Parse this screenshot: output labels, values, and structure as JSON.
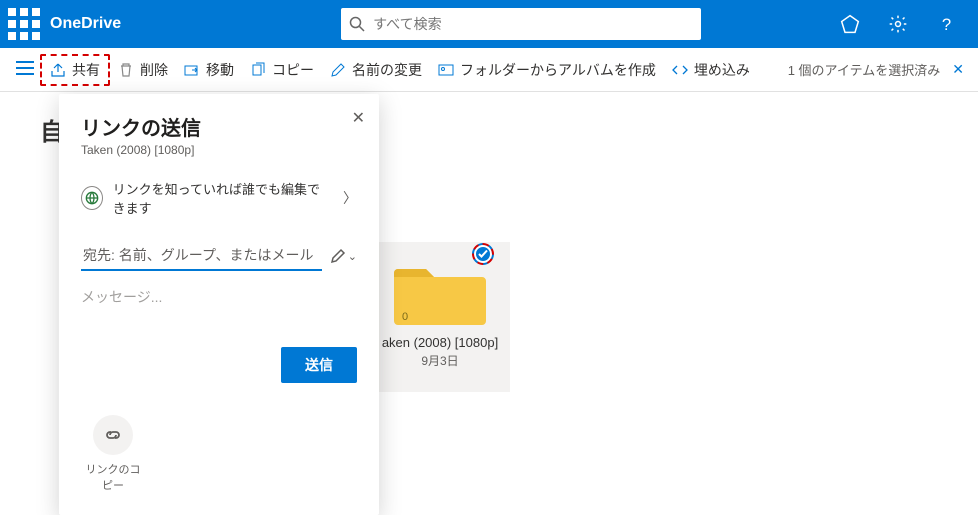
{
  "header": {
    "brand": "OneDrive",
    "search_placeholder": "すべて検索"
  },
  "cmdbar": {
    "share": "共有",
    "delete": "削除",
    "move": "移動",
    "copy": "コピー",
    "rename": "名前の変更",
    "create_album": "フォルダーからアルバムを作成",
    "embed": "埋め込み",
    "selection_status": "1 個のアイテムを選択済み"
  },
  "page": {
    "title_visible_fragment": "自"
  },
  "folder": {
    "name": "aken (2008) [1080p]",
    "date": "9月3日",
    "count": "0"
  },
  "dialog": {
    "title": "リンクの送信",
    "subtitle": "Taken (2008) [1080p]",
    "permission_label": "リンクを知っていれば誰でも編集できます",
    "recipient_placeholder": "宛先: 名前、グループ、またはメール",
    "message_placeholder": "メッセージ...",
    "send_label": "送信",
    "copy_link_label": "リンクのコピー"
  }
}
